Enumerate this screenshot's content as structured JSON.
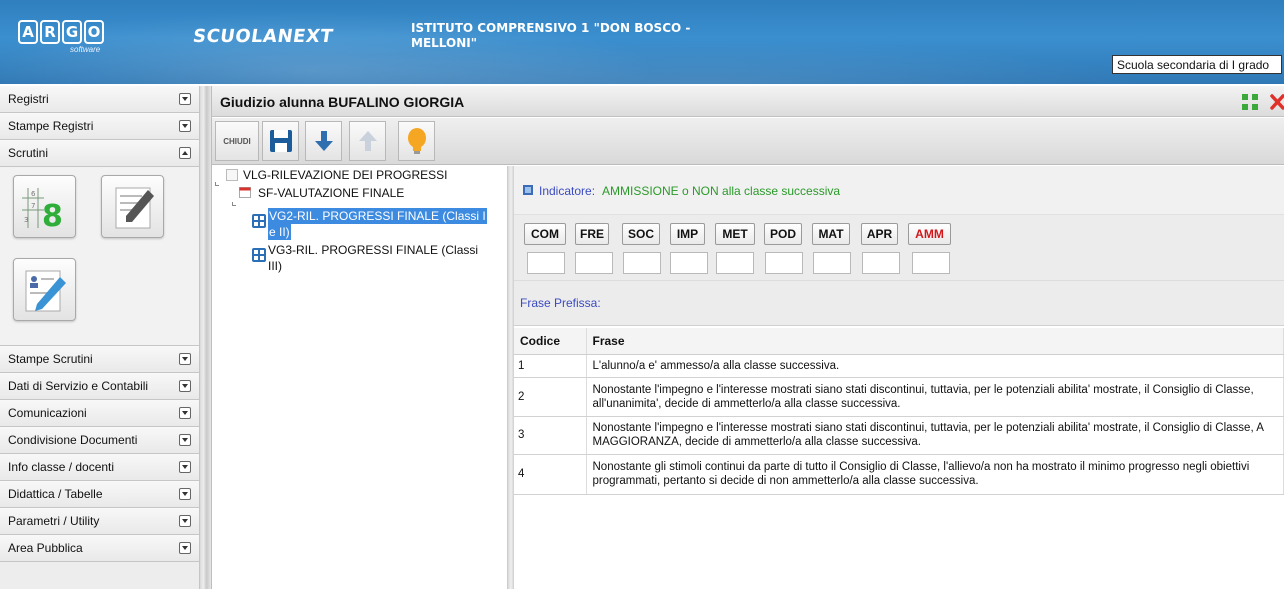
{
  "header": {
    "logo_letters": [
      "A",
      "R",
      "G",
      "O"
    ],
    "logo_sub": "software",
    "brand": "SCUOLANEXT",
    "school_name": "ISTITUTO COMPRENSIVO 1 \"DON BOSCO - MELLONI\"",
    "school_type": "Scuola secondaria di I grado"
  },
  "sidebar": {
    "items_top": [
      {
        "label": "Registri",
        "state": "collapsed"
      },
      {
        "label": "Stampe Registri",
        "state": "collapsed"
      },
      {
        "label": "Scrutini",
        "state": "expanded"
      }
    ],
    "items_bottom": [
      {
        "label": "Stampe Scrutini"
      },
      {
        "label": "Dati di Servizio e Contabili"
      },
      {
        "label": "Comunicazioni"
      },
      {
        "label": "Condivisione Documenti"
      },
      {
        "label": "Info classe / docenti"
      },
      {
        "label": "Didattica / Tabelle"
      },
      {
        "label": "Parametri / Utility"
      },
      {
        "label": "Area Pubblica"
      }
    ]
  },
  "main": {
    "title": "Giudizio alunna BUFALINO GIORGIA",
    "toolbar": {
      "close_label": "CHIUDI",
      "icons": [
        "save-icon",
        "arrow-down-icon",
        "arrow-up-icon",
        "lightbulb-icon"
      ]
    },
    "tree": {
      "root": "VLG-RILEVAZIONE DEI PROGRESSI",
      "child": "SF-VALUTAZIONE FINALE",
      "leaves": [
        {
          "label_line1": "VG2-RIL. PROGRESSI FINALE (Classi I",
          "label_line2": "e II)",
          "selected": true
        },
        {
          "label_line1": "VG3-RIL. PROGRESSI FINALE (Classi",
          "label_line2": "III)",
          "selected": false
        }
      ]
    },
    "indicator": {
      "label": "Indicatore:",
      "value": "AMMISSIONE o NON alla classe successiva"
    },
    "codes": [
      {
        "label": "COM",
        "active": false
      },
      {
        "label": "FRE",
        "active": false
      },
      {
        "label": "SOC",
        "active": false
      },
      {
        "label": "IMP",
        "active": false
      },
      {
        "label": "MET",
        "active": false
      },
      {
        "label": "POD",
        "active": false
      },
      {
        "label": "MAT",
        "active": false
      },
      {
        "label": "APR",
        "active": false
      },
      {
        "label": "AMM",
        "active": true
      }
    ],
    "prefix_label": "Frase Prefissa:",
    "table": {
      "headers": [
        "Codice",
        "Frase"
      ],
      "rows": [
        {
          "code": "1",
          "text": "L'alunno/a e' ammesso/a alla classe successiva."
        },
        {
          "code": "2",
          "text": "Nonostante l'impegno e l'interesse mostrati siano stati discontinui, tuttavia, per le potenziali abilita' mostrate, il Consiglio di Classe, all'unanimita', decide di ammetterlo/a alla classe successiva."
        },
        {
          "code": "3",
          "text": "Nonostante l'impegno e l'interesse mostrati siano stati discontinui, tuttavia, per le potenziali abilita' mostrate, il Consiglio di Classe, A MAGGIORANZA, decide di ammetterlo/a alla classe successiva."
        },
        {
          "code": "4",
          "text": "Nonostante gli stimoli continui da parte di tutto il Consiglio di Classe, l'allievo/a non ha mostrato il minimo progresso negli obiettivi programmati, pertanto si decide di non ammetterlo/a alla classe successiva."
        }
      ]
    }
  },
  "colors": {
    "header_blue": "#3588c8",
    "indicator_green": "#2a9a2a",
    "prefix_blue": "#3b4bc0",
    "active_code_red": "#d0181c",
    "selection_blue": "#3d8be0"
  }
}
